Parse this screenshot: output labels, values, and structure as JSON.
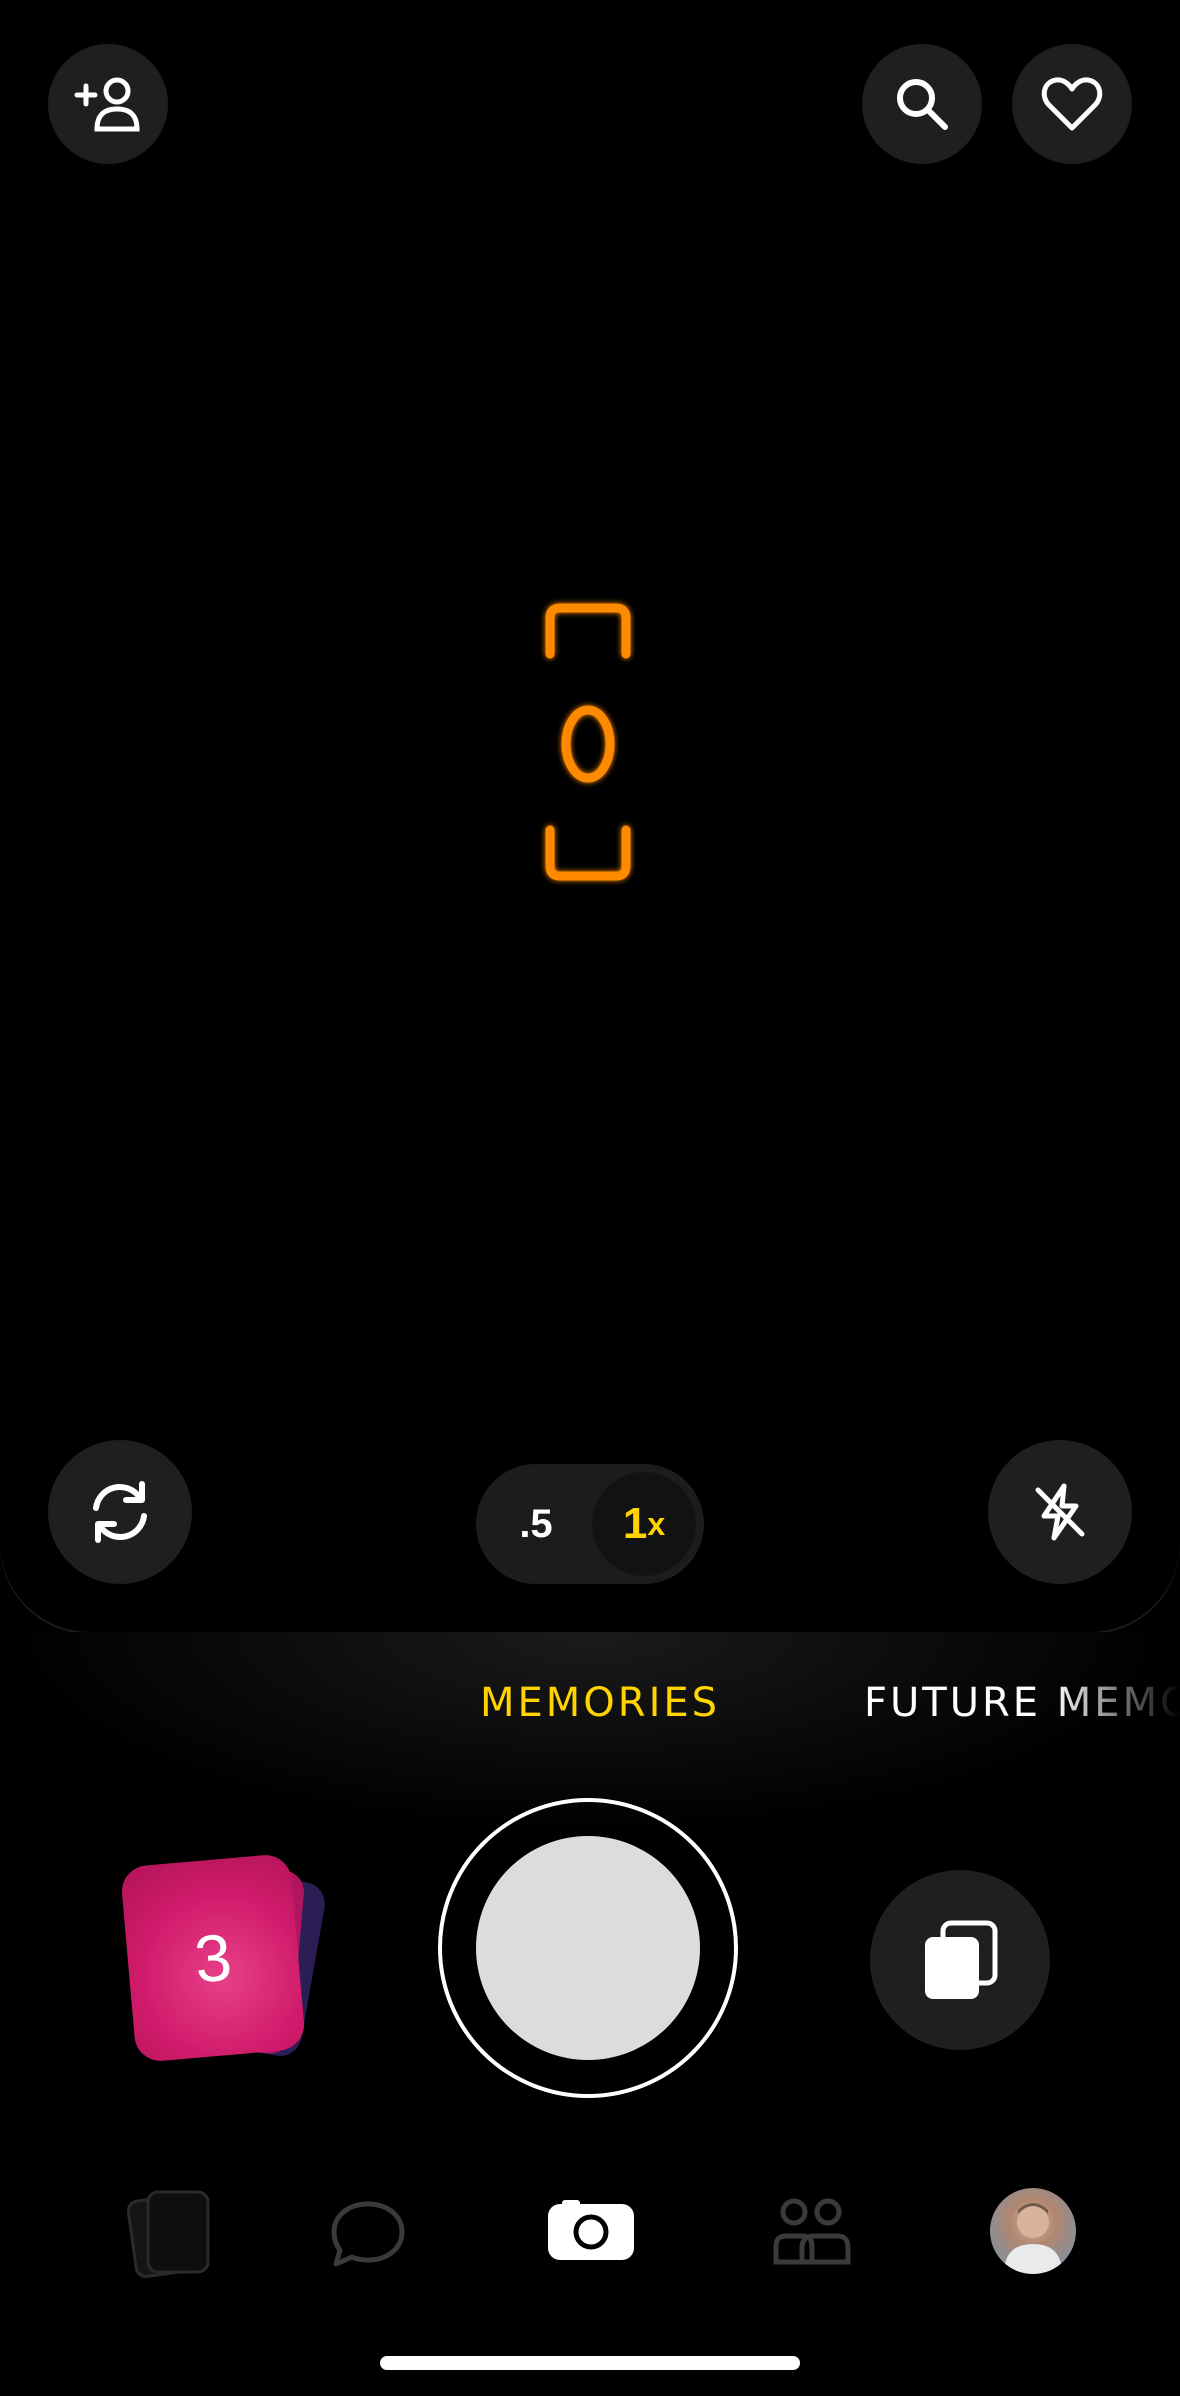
{
  "top_bar": {
    "add_friend_icon": "person-plus-icon",
    "search_icon": "search-icon",
    "favorites_icon": "heart-icon"
  },
  "camera": {
    "focus_indicator_icon": "focus-bracket-icon",
    "focus_color": "#ff8a00"
  },
  "controls": {
    "flip_camera_icon": "camera-flip-icon",
    "flash_icon": "flash-off-icon",
    "zoom": {
      "options": [
        ".5",
        "1"
      ],
      "selected_suffix": "x",
      "selected_index": 1
    }
  },
  "modes": {
    "active": "MEMORIES",
    "next": "FUTURE MEMORIES",
    "active_color": "#ffd400"
  },
  "capture": {
    "memories_count": "3",
    "stack_color": "#d81b6b",
    "gallery_icon": "photo-stack-icon"
  },
  "tab_bar": {
    "items": [
      {
        "name": "memories-tab",
        "icon": "cards-icon"
      },
      {
        "name": "chat-tab",
        "icon": "chat-bubble-icon"
      },
      {
        "name": "camera-tab",
        "icon": "camera-icon"
      },
      {
        "name": "friends-tab",
        "icon": "people-icon"
      },
      {
        "name": "profile-tab",
        "icon": "avatar"
      }
    ]
  }
}
